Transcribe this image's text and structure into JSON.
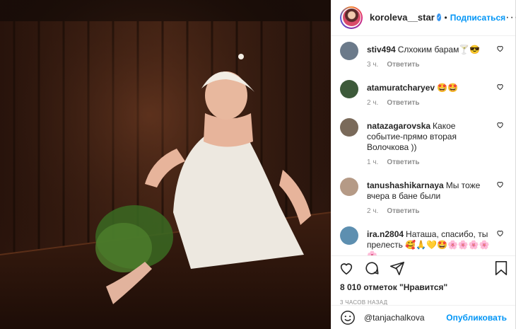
{
  "header": {
    "username": "koroleva__star",
    "verified_mark": "✓",
    "separator": "•",
    "follow_label": "Подписаться",
    "more_label": "···"
  },
  "comments": [
    {
      "user": "stiv494",
      "text": "Слхоким барам🍸😎",
      "time": "3 ч.",
      "reply": "Ответить",
      "avatar_color": "#6b7a8a"
    },
    {
      "user": "atamuratcharyev",
      "text": "🤩🤩",
      "time": "2 ч.",
      "reply": "Ответить",
      "avatar_color": "#3d5a3a"
    },
    {
      "user": "natazagarovska",
      "text": "Какое событие-прямо вторая Волочкова ))",
      "time": "1 ч.",
      "reply": "Ответить",
      "avatar_color": "#7a6a5a"
    },
    {
      "user": "tanushashikarnaya",
      "text": "Мы тоже вчера в бане были",
      "time": "2 ч.",
      "reply": "Ответить",
      "avatar_color": "#b59a86"
    },
    {
      "user": "ira.n2804",
      "text": "Наташа, спасибо, ты прелесть 🥰🙏💛🤩🌸🌸🌸🌸🌸",
      "time": "",
      "reply": "",
      "avatar_color": "#5d8fb0"
    }
  ],
  "likes": "8 010 отметок \"Нравится\"",
  "timestamp": "3 ЧАСОВ НАЗАД",
  "composer": {
    "value": "@tanjachalkova",
    "publish_label": "Опубликовать"
  },
  "icons": {
    "like": "heart-icon",
    "comment": "comment-icon",
    "share": "share-icon",
    "save": "bookmark-icon",
    "emoji": "emoji-icon"
  },
  "colors": {
    "accent": "#0095f6",
    "text": "#262626",
    "muted": "#8e8e8e"
  }
}
